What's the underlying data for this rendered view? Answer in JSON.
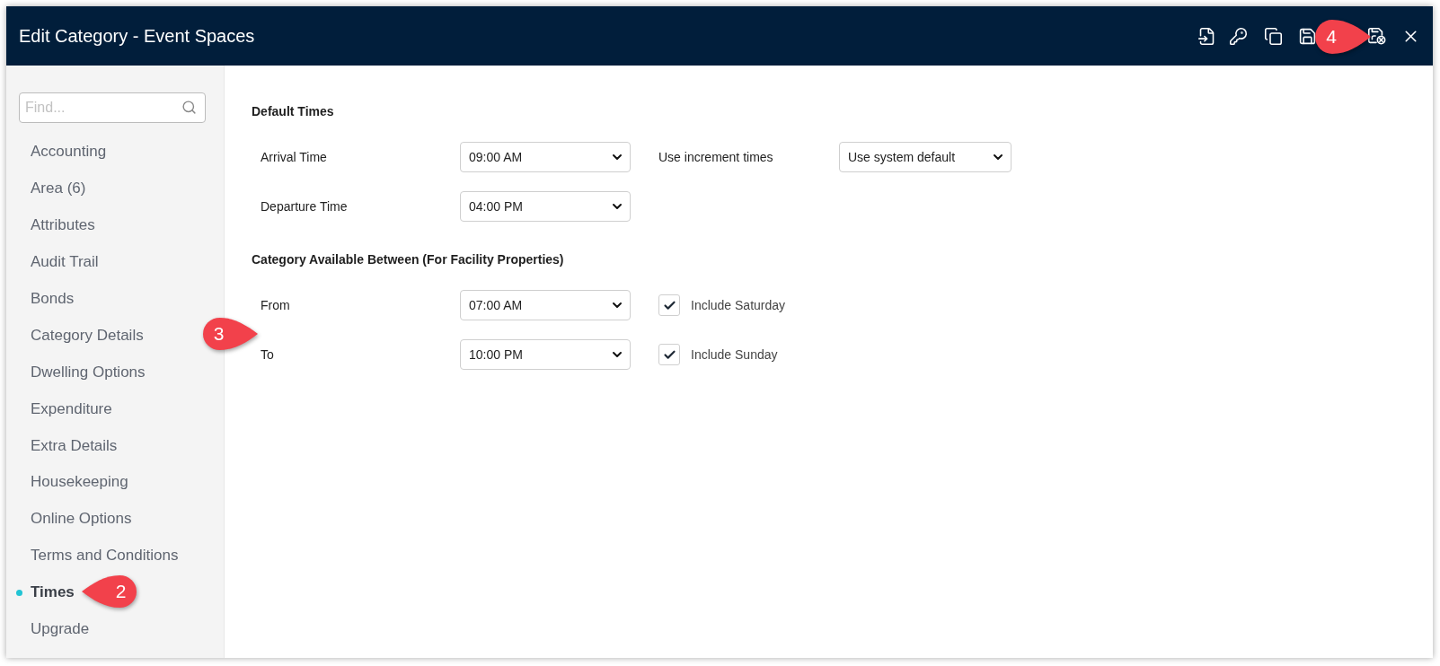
{
  "window": {
    "title": "Edit Category - Event Spaces"
  },
  "sidebar": {
    "search": {
      "placeholder": "Find..."
    },
    "items": [
      {
        "label": "Accounting",
        "selected": false
      },
      {
        "label": "Area (6)",
        "selected": false
      },
      {
        "label": "Attributes",
        "selected": false
      },
      {
        "label": "Audit Trail",
        "selected": false
      },
      {
        "label": "Bonds",
        "selected": false
      },
      {
        "label": "Category Details",
        "selected": false
      },
      {
        "label": "Dwelling Options",
        "selected": false
      },
      {
        "label": "Expenditure",
        "selected": false
      },
      {
        "label": "Extra Details",
        "selected": false
      },
      {
        "label": "Housekeeping",
        "selected": false
      },
      {
        "label": "Online Options",
        "selected": false
      },
      {
        "label": "Terms and Conditions",
        "selected": false
      },
      {
        "label": "Times",
        "selected": true
      },
      {
        "label": "Upgrade",
        "selected": false
      }
    ]
  },
  "sections": [
    {
      "heading": "Default Times",
      "rows": [
        {
          "label": "Arrival Time",
          "value": "09:00 AM",
          "extra": {
            "kind": "select",
            "label": "Use increment times",
            "value": "Use system default"
          }
        },
        {
          "label": "Departure Time",
          "value": "04:00 PM"
        }
      ]
    },
    {
      "heading": "Category Available Between (For Facility Properties)",
      "rows": [
        {
          "label": "From",
          "value": "07:00 AM",
          "extra": {
            "kind": "checkbox",
            "label": "Include Saturday",
            "checked": true
          }
        },
        {
          "label": "To",
          "value": "10:00 PM",
          "extra": {
            "kind": "checkbox",
            "label": "Include Sunday",
            "checked": true
          }
        }
      ]
    }
  ],
  "callouts": [
    {
      "number": "2",
      "points_left": true
    },
    {
      "number": "3",
      "points_left": false
    },
    {
      "number": "4",
      "points_left": false
    }
  ]
}
